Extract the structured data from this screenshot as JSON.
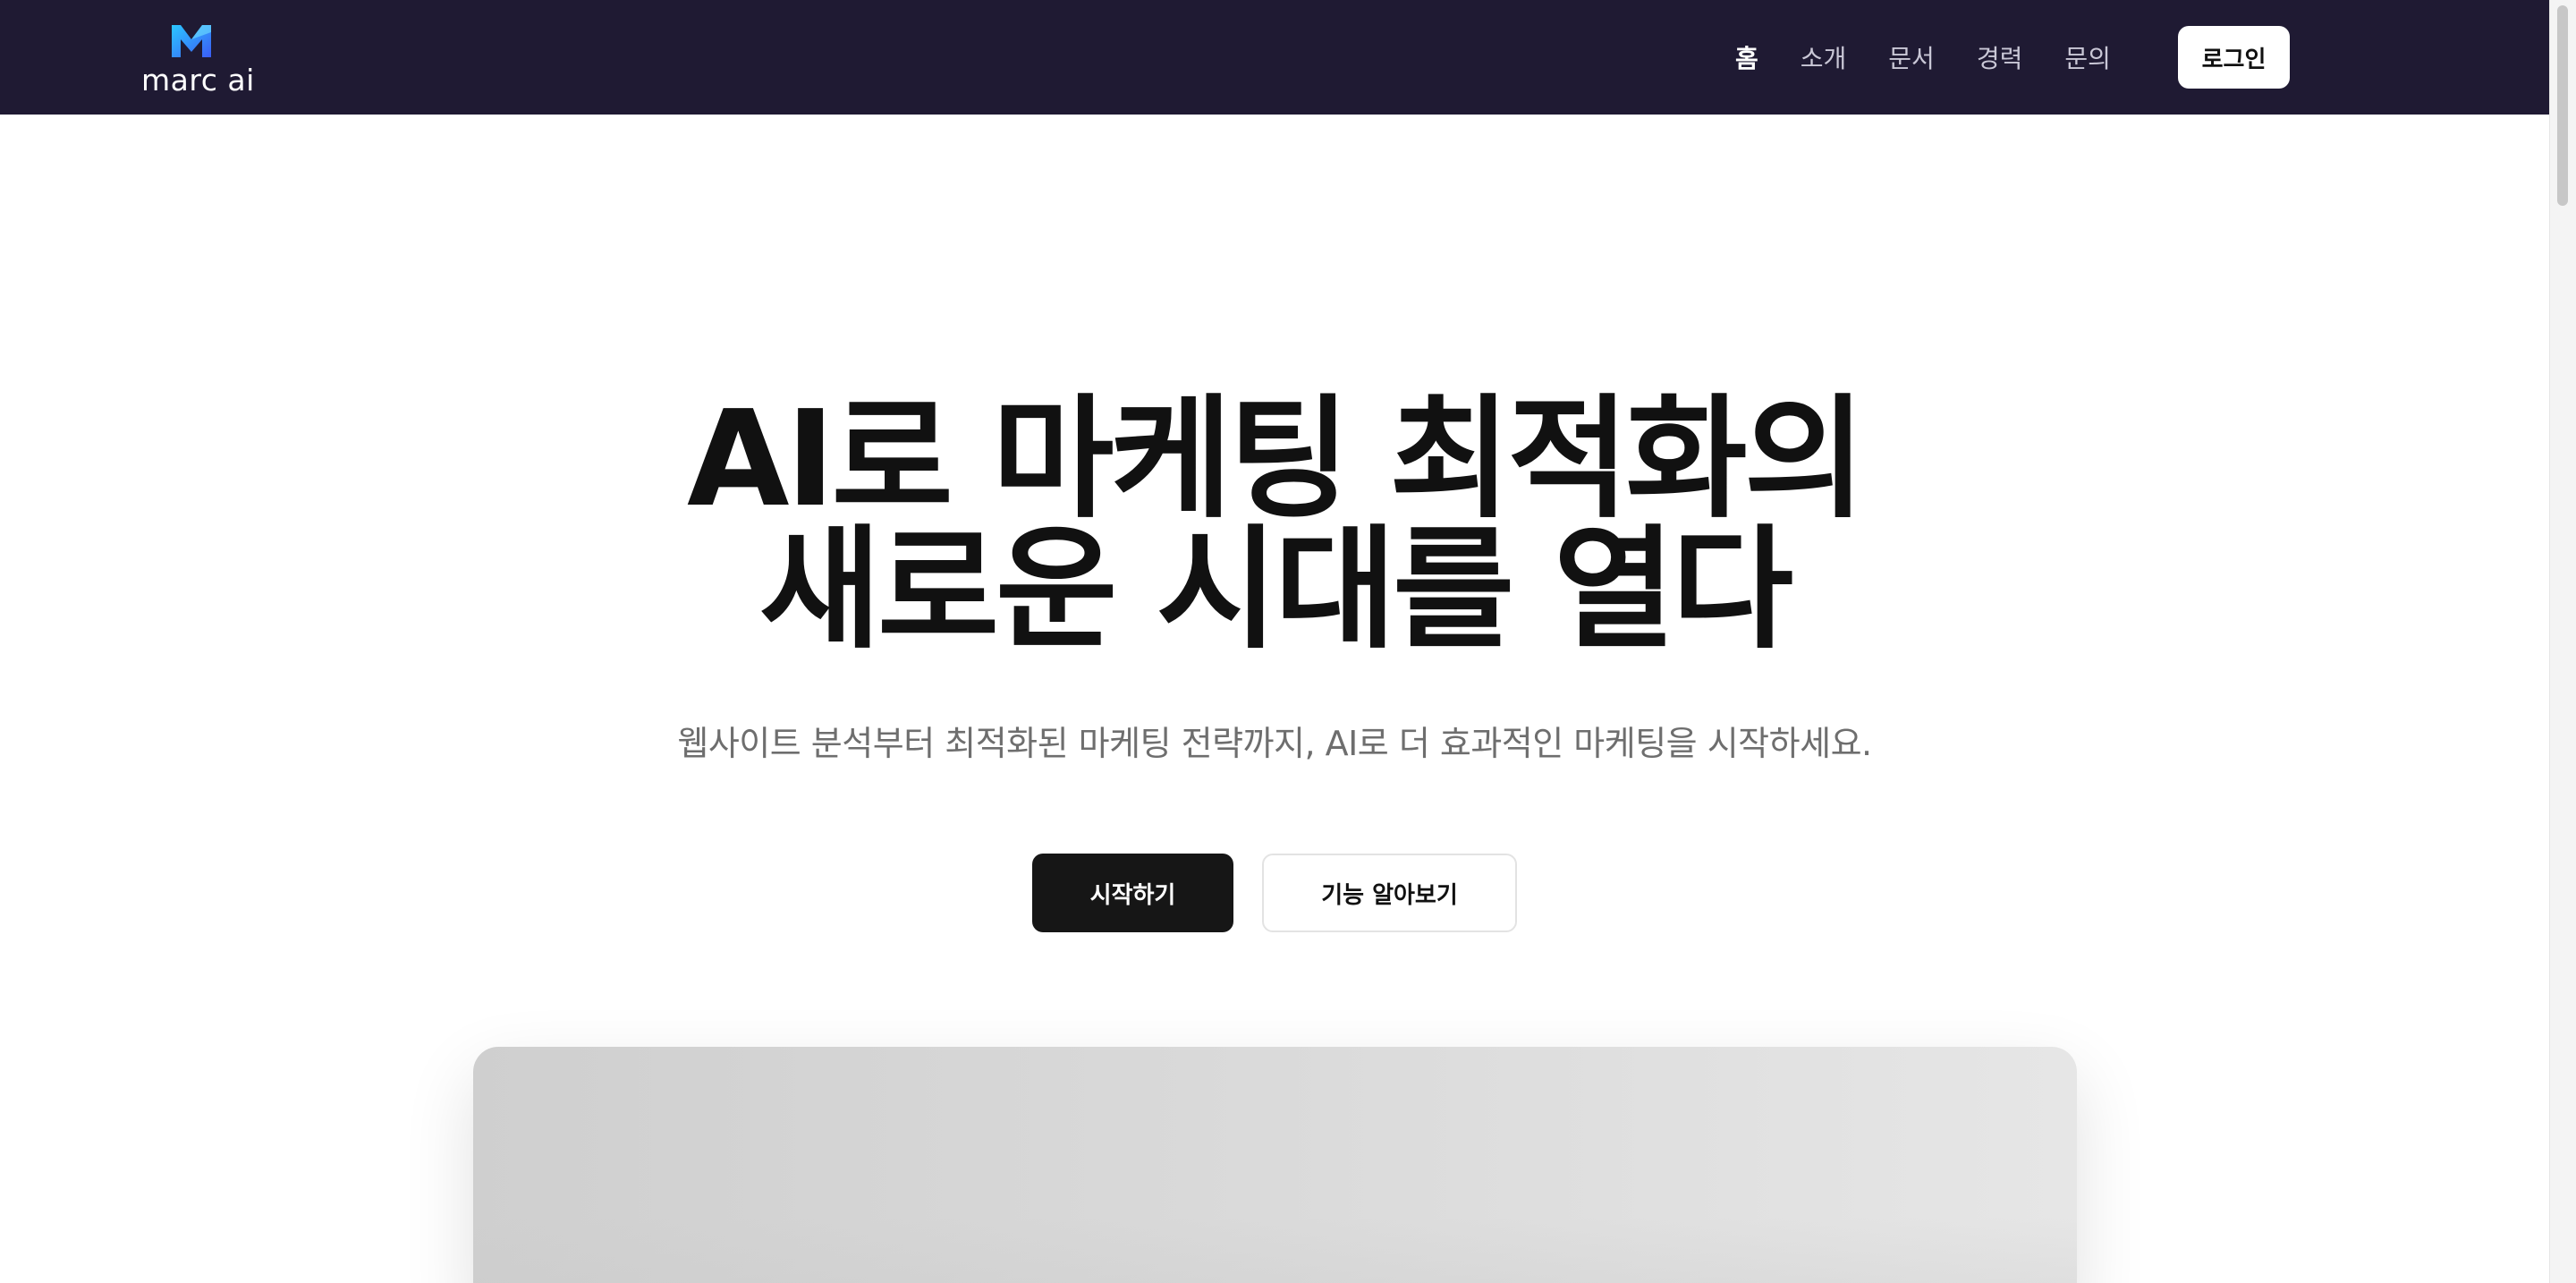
{
  "brand": {
    "name": "marc ai",
    "logo_icon": "m-logo-icon"
  },
  "nav": {
    "items": [
      {
        "label": "홈",
        "active": true
      },
      {
        "label": "소개",
        "active": false
      },
      {
        "label": "문서",
        "active": false
      },
      {
        "label": "경력",
        "active": false
      },
      {
        "label": "문의",
        "active": false
      }
    ],
    "login_label": "로그인"
  },
  "hero": {
    "title_line1": "AI로 마케팅 최적화의",
    "title_line2": "새로운 시대를 열다",
    "subtitle": "웹사이트 분석부터 최적화된 마케팅 전략까지, AI로 더 효과적인 마케팅을 시작하세요.",
    "primary_button": "시작하기",
    "secondary_button": "기능 알아보기"
  },
  "colors": {
    "header_bg": "#1f1a33",
    "logo_gradient_start": "#2bc6ff",
    "logo_gradient_end": "#3b5cf6",
    "primary_button_bg": "#161616"
  }
}
